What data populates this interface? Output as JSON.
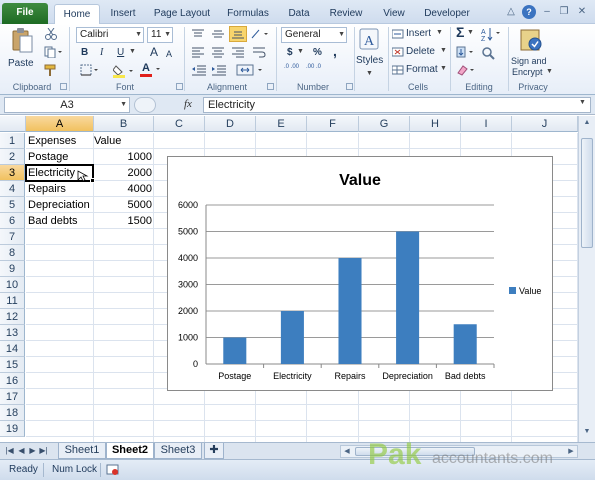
{
  "ribbon_tabs": {
    "file": "File",
    "items": [
      "Home",
      "Insert",
      "Page Layout",
      "Formulas",
      "Data",
      "Review",
      "View",
      "Developer"
    ]
  },
  "ribbon": {
    "paste_label": "Paste",
    "font_name": "Calibri",
    "font_size": "11",
    "bold": "B",
    "italic": "I",
    "underline": "U",
    "grow_font": "A",
    "shrink_font": "A",
    "font_color_letter": "A",
    "number_format": "General",
    "currency": "$",
    "percent": "%",
    "comma": ",",
    "inc_decimal": ".0 .00",
    "dec_decimal": ".00 .0",
    "styles_label": "Styles",
    "insert_label": "Insert",
    "delete_label": "Delete",
    "format_label": "Format",
    "sum_symbol": "Σ",
    "sign_label_1": "Sign and",
    "sign_label_2": "Encrypt",
    "groups": [
      "Clipboard",
      "Font",
      "Alignment",
      "Number",
      "Cells",
      "Editing",
      "Privacy"
    ],
    "colors": {
      "accent_green": "#1d6b23",
      "highlight": "#f7e64a",
      "font_red": "#e0201b"
    }
  },
  "formula_bar": {
    "name_box": "A3",
    "fx": "fx",
    "content": "Electricity"
  },
  "grid": {
    "columns": [
      "A",
      "B",
      "C",
      "D",
      "E",
      "F",
      "G",
      "H",
      "I",
      "J"
    ],
    "rows": [
      "1",
      "2",
      "3",
      "4",
      "5",
      "6",
      "7",
      "8",
      "9",
      "10",
      "11",
      "12",
      "13",
      "14",
      "15",
      "16",
      "17",
      "18",
      "19"
    ],
    "selected_cell": "A3",
    "cells": [
      {
        "a": "Expenses",
        "b": "Value"
      },
      {
        "a": "Postage",
        "b": "1000"
      },
      {
        "a": "Electricity",
        "b": "2000"
      },
      {
        "a": "Repairs",
        "b": "4000"
      },
      {
        "a": "Depreciation",
        "b": "5000"
      },
      {
        "a": "Bad debts",
        "b": "1500"
      }
    ]
  },
  "chart_data": {
    "type": "bar",
    "title": "Value",
    "categories": [
      "Postage",
      "Electricity",
      "Repairs",
      "Depreciation",
      "Bad debts"
    ],
    "series": [
      {
        "name": "Value",
        "values": [
          1000,
          2000,
          4000,
          5000,
          1500
        ],
        "color": "#3d7ebf"
      }
    ],
    "yticks": [
      "0",
      "1000",
      "2000",
      "3000",
      "4000",
      "5000",
      "6000"
    ],
    "ylim": [
      0,
      6000
    ],
    "grid": true,
    "legend": "right",
    "xlabel": "",
    "ylabel": ""
  },
  "sheets": {
    "tabs": [
      "Sheet1",
      "Sheet2",
      "Sheet3"
    ],
    "active": "Sheet2"
  },
  "status": {
    "mode": "Ready",
    "num_lock": "Num Lock"
  },
  "watermark": {
    "brand_1": "Pak",
    "brand_2": "accountants.com"
  }
}
